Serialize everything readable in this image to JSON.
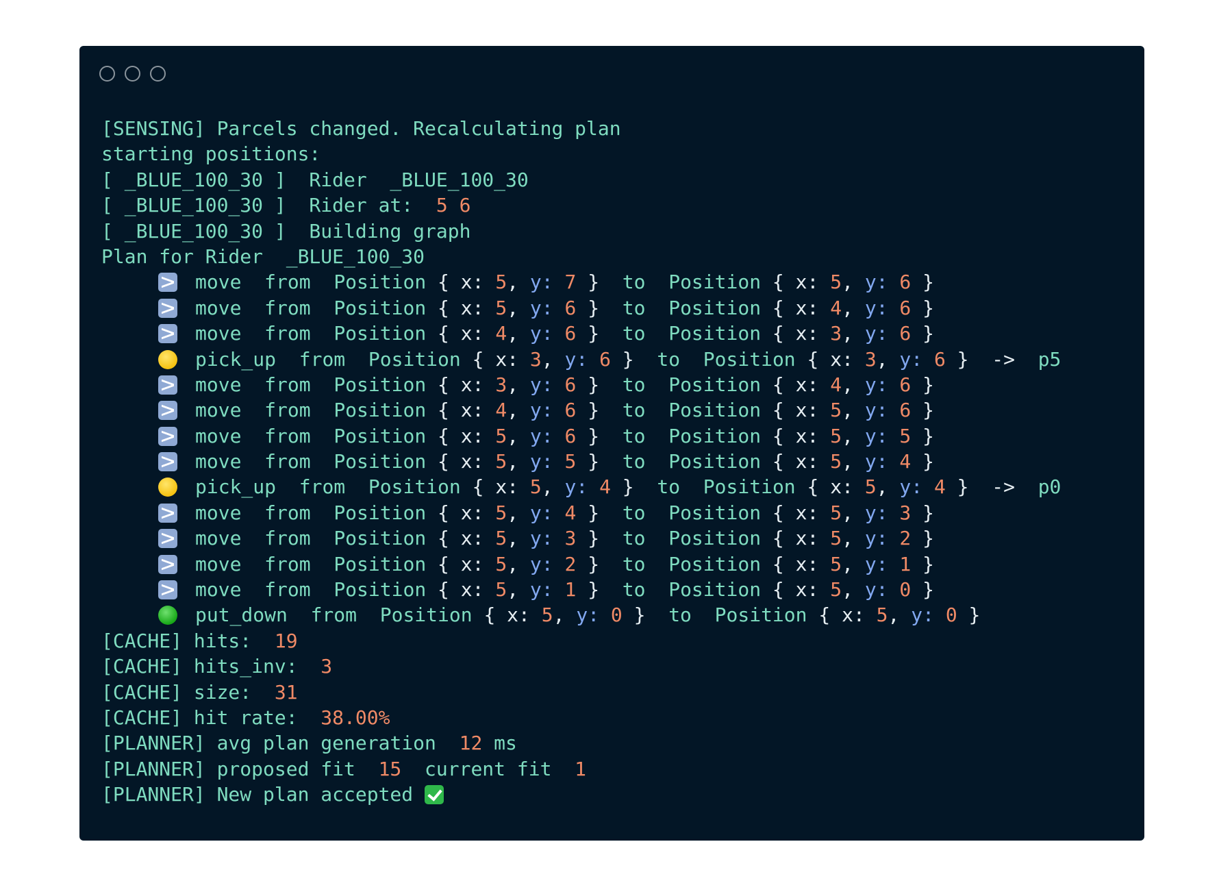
{
  "log_lines": [
    {
      "kind": "text",
      "segments": [
        {
          "t": "[SENSING] Parcels changed. Recalculating plan",
          "c": "text"
        }
      ]
    },
    {
      "kind": "text",
      "segments": [
        {
          "t": "starting positions:",
          "c": "text"
        }
      ]
    },
    {
      "kind": "text",
      "segments": [
        {
          "t": "[ _BLUE_100_30 ]  Rider  _BLUE_100_30",
          "c": "text"
        }
      ]
    },
    {
      "kind": "text",
      "segments": [
        {
          "t": "[ _BLUE_100_30 ]  Rider at:  ",
          "c": "text"
        },
        {
          "t": "5 6",
          "c": "num"
        }
      ]
    },
    {
      "kind": "text",
      "segments": [
        {
          "t": "[ _BLUE_100_30 ]  Building graph",
          "c": "text"
        }
      ]
    },
    {
      "kind": "text",
      "segments": [
        {
          "t": "Plan for Rider  _BLUE_100_30",
          "c": "text"
        }
      ]
    },
    {
      "kind": "step",
      "icon": "shuffle-icon",
      "action": "move",
      "from": [
        "5",
        "7"
      ],
      "to": [
        "5",
        "6"
      ],
      "target": ""
    },
    {
      "kind": "step",
      "icon": "shuffle-icon",
      "action": "move",
      "from": [
        "5",
        "6"
      ],
      "to": [
        "4",
        "6"
      ],
      "target": ""
    },
    {
      "kind": "step",
      "icon": "shuffle-icon",
      "action": "move",
      "from": [
        "4",
        "6"
      ],
      "to": [
        "3",
        "6"
      ],
      "target": ""
    },
    {
      "kind": "step",
      "icon": "yellow-circle-icon",
      "action": "pick_up",
      "from": [
        "3",
        "6"
      ],
      "to": [
        "3",
        "6"
      ],
      "target": "p5"
    },
    {
      "kind": "step",
      "icon": "shuffle-icon",
      "action": "move",
      "from": [
        "3",
        "6"
      ],
      "to": [
        "4",
        "6"
      ],
      "target": ""
    },
    {
      "kind": "step",
      "icon": "shuffle-icon",
      "action": "move",
      "from": [
        "4",
        "6"
      ],
      "to": [
        "5",
        "6"
      ],
      "target": ""
    },
    {
      "kind": "step",
      "icon": "shuffle-icon",
      "action": "move",
      "from": [
        "5",
        "6"
      ],
      "to": [
        "5",
        "5"
      ],
      "target": ""
    },
    {
      "kind": "step",
      "icon": "shuffle-icon",
      "action": "move",
      "from": [
        "5",
        "5"
      ],
      "to": [
        "5",
        "4"
      ],
      "target": ""
    },
    {
      "kind": "step",
      "icon": "yellow-circle-icon",
      "action": "pick_up",
      "from": [
        "5",
        "4"
      ],
      "to": [
        "5",
        "4"
      ],
      "target": "p0"
    },
    {
      "kind": "step",
      "icon": "shuffle-icon",
      "action": "move",
      "from": [
        "5",
        "4"
      ],
      "to": [
        "5",
        "3"
      ],
      "target": ""
    },
    {
      "kind": "step",
      "icon": "shuffle-icon",
      "action": "move",
      "from": [
        "5",
        "3"
      ],
      "to": [
        "5",
        "2"
      ],
      "target": ""
    },
    {
      "kind": "step",
      "icon": "shuffle-icon",
      "action": "move",
      "from": [
        "5",
        "2"
      ],
      "to": [
        "5",
        "1"
      ],
      "target": ""
    },
    {
      "kind": "step",
      "icon": "shuffle-icon",
      "action": "move",
      "from": [
        "5",
        "1"
      ],
      "to": [
        "5",
        "0"
      ],
      "target": ""
    },
    {
      "kind": "step",
      "icon": "green-circle-icon",
      "action": "put_down",
      "from": [
        "5",
        "0"
      ],
      "to": [
        "5",
        "0"
      ],
      "target": ""
    },
    {
      "kind": "text",
      "segments": [
        {
          "t": "[CACHE] hits:  ",
          "c": "text"
        },
        {
          "t": "19",
          "c": "num"
        }
      ]
    },
    {
      "kind": "text",
      "segments": [
        {
          "t": "[CACHE] hits_inv:  ",
          "c": "text"
        },
        {
          "t": "3",
          "c": "num"
        }
      ]
    },
    {
      "kind": "text",
      "segments": [
        {
          "t": "[CACHE] size:  ",
          "c": "text"
        },
        {
          "t": "31",
          "c": "num"
        }
      ]
    },
    {
      "kind": "text",
      "segments": [
        {
          "t": "[CACHE] hit rate:  ",
          "c": "text"
        },
        {
          "t": "38.00%",
          "c": "num"
        }
      ]
    },
    {
      "kind": "text",
      "segments": [
        {
          "t": "[PLANNER] avg plan generation  ",
          "c": "text"
        },
        {
          "t": "12",
          "c": "num"
        },
        {
          "t": " ms",
          "c": "text"
        }
      ]
    },
    {
      "kind": "text",
      "segments": [
        {
          "t": "[PLANNER] proposed fit  ",
          "c": "text"
        },
        {
          "t": "15",
          "c": "num"
        },
        {
          "t": "  current fit  ",
          "c": "text"
        },
        {
          "t": "1",
          "c": "num"
        }
      ]
    },
    {
      "kind": "text",
      "segments": [
        {
          "t": "[PLANNER] New plan accepted ",
          "c": "text"
        }
      ],
      "check_icon": true
    }
  ],
  "step_words": {
    "from": "from",
    "position": "Position",
    "to": "to",
    "arrow": "->",
    "x_key": "x",
    "y_key": "y"
  },
  "colors": {
    "background": "#031626",
    "text": "#7fdcc0",
    "number": "#f08a66",
    "key": "#82a8f0",
    "plain": "#e6eef2"
  }
}
